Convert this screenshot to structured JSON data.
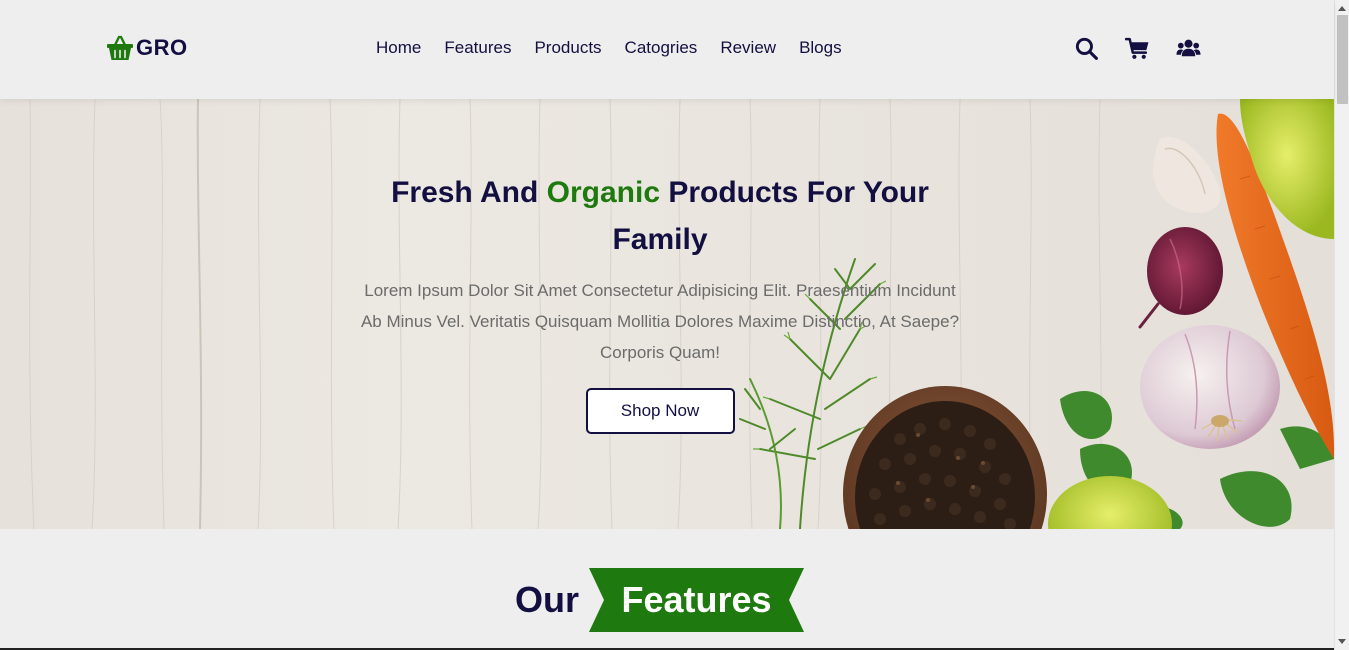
{
  "logo": {
    "text": "GRO",
    "icon": "shopping-basket-icon",
    "icon_color": "#1e7a0f"
  },
  "nav": {
    "items": [
      "Home",
      "Features",
      "Products",
      "Catogries",
      "Review",
      "Blogs"
    ]
  },
  "header_icons": [
    "search-icon",
    "cart-icon",
    "users-icon"
  ],
  "hero": {
    "title_part1": "Fresh And ",
    "title_accent": "Organic",
    "title_part2": " Products For Your Family",
    "description": "Lorem Ipsum Dolor Sit Amet Consectetur Adipisicing Elit. Praesentium Incidunt Ab Minus Vel. Veritatis Quisquam Mollitia Dolores Maxime Distinctio, At Saepe? Corporis Quam!",
    "button_label": "Shop Now"
  },
  "features": {
    "heading_part1": "Our",
    "heading_part2": "Features"
  },
  "colors": {
    "primary": "#130f40",
    "accent": "#1e7a0f",
    "background": "#eeeeee"
  }
}
